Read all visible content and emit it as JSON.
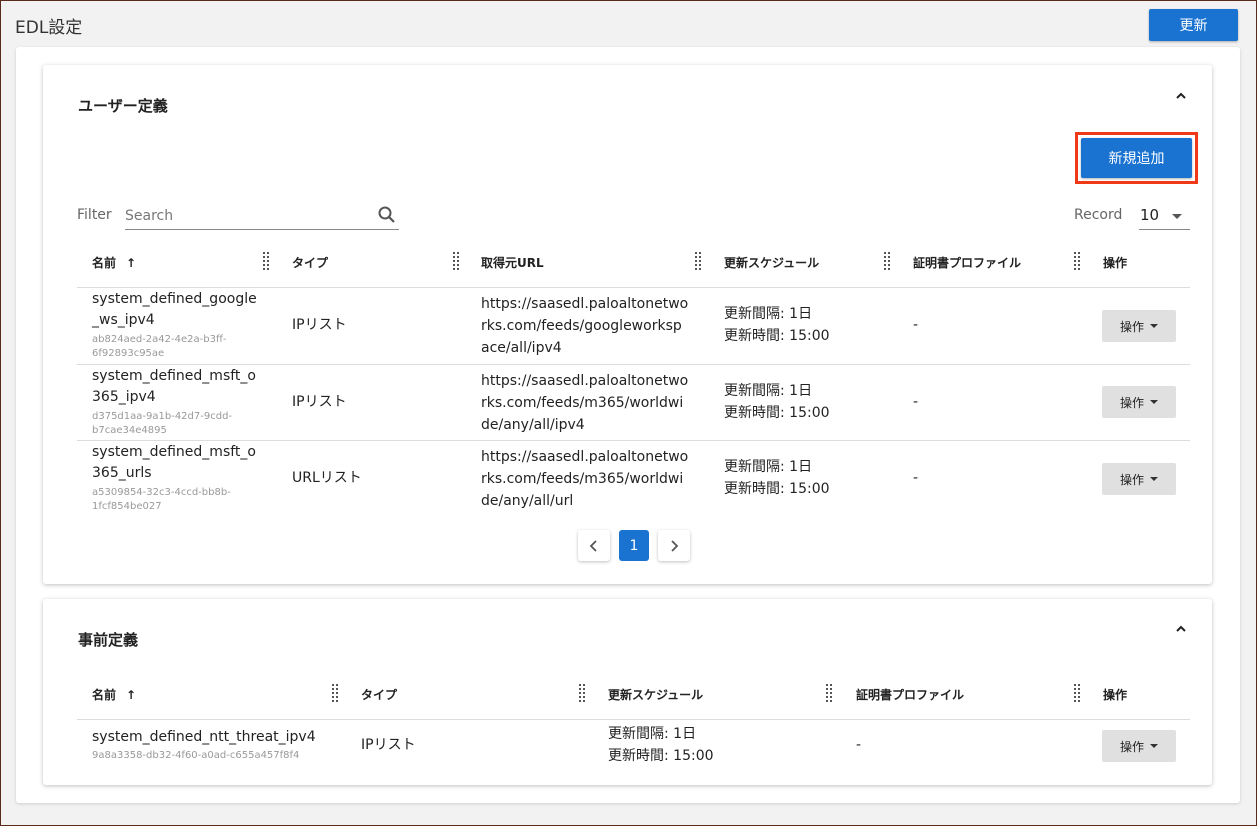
{
  "header": {
    "title": "EDL設定",
    "update_label": "更新"
  },
  "user_section": {
    "title": "ユーザー定義",
    "add_label": "新規追加",
    "filter_label": "Filter",
    "search_placeholder": "Search",
    "record_label": "Record",
    "record_value": "10",
    "columns": [
      "名前",
      "タイプ",
      "取得元URL",
      "更新スケジュール",
      "証明書プロファイル",
      "操作"
    ],
    "rows": [
      {
        "name_l1": "system_defined_google",
        "name_l2": "_ws_ipv4",
        "uuid_l1": "ab824aed-2a42-4e2a-b3ff-",
        "uuid_l2": "6f92893c95ae",
        "type": "IPリスト",
        "url_l1": "https://saasedl.paloaltonetwo",
        "url_l2": "rks.com/feeds/googleworksp",
        "url_l3": "ace/all/ipv4",
        "interval": "更新間隔: 1日",
        "time": "更新時間: 15:00",
        "cert": "-",
        "op": "操作"
      },
      {
        "name_l1": "system_defined_msft_o",
        "name_l2": "365_ipv4",
        "uuid_l1": "d375d1aa-9a1b-42d7-9cdd-",
        "uuid_l2": "b7cae34e4895",
        "type": "IPリスト",
        "url_l1": "https://saasedl.paloaltonetwo",
        "url_l2": "rks.com/feeds/m365/worldwi",
        "url_l3": "de/any/all/ipv4",
        "interval": "更新間隔: 1日",
        "time": "更新時間: 15:00",
        "cert": "-",
        "op": "操作"
      },
      {
        "name_l1": "system_defined_msft_o",
        "name_l2": "365_urls",
        "uuid_l1": "a5309854-32c3-4ccd-bb8b-",
        "uuid_l2": "1fcf854be027",
        "type": "URLリスト",
        "url_l1": "https://saasedl.paloaltonetwo",
        "url_l2": "rks.com/feeds/m365/worldwi",
        "url_l3": "de/any/all/url",
        "interval": "更新間隔: 1日",
        "time": "更新時間: 15:00",
        "cert": "-",
        "op": "操作"
      }
    ],
    "pagination": {
      "prev": "‹",
      "current": "1",
      "next": "›"
    }
  },
  "predefined_section": {
    "title": "事前定義",
    "columns": [
      "名前",
      "タイプ",
      "更新スケジュール",
      "証明書プロファイル",
      "操作"
    ],
    "rows": [
      {
        "name": "system_defined_ntt_threat_ipv4",
        "uuid": "9a8a3358-db32-4f60-a0ad-c655a457f8f4",
        "type": "IPリスト",
        "interval": "更新間隔: 1日",
        "time": "更新時間: 15:00",
        "cert": "-",
        "op": "操作"
      }
    ]
  },
  "colors": {
    "primary": "#1a73d1",
    "highlight": "#f03a17"
  },
  "icons": [
    "search-icon",
    "chevron-up-icon",
    "column-grip-icon",
    "sort-arrow-up-icon",
    "caret-down-icon",
    "chevron-left-icon",
    "chevron-right-icon"
  ]
}
